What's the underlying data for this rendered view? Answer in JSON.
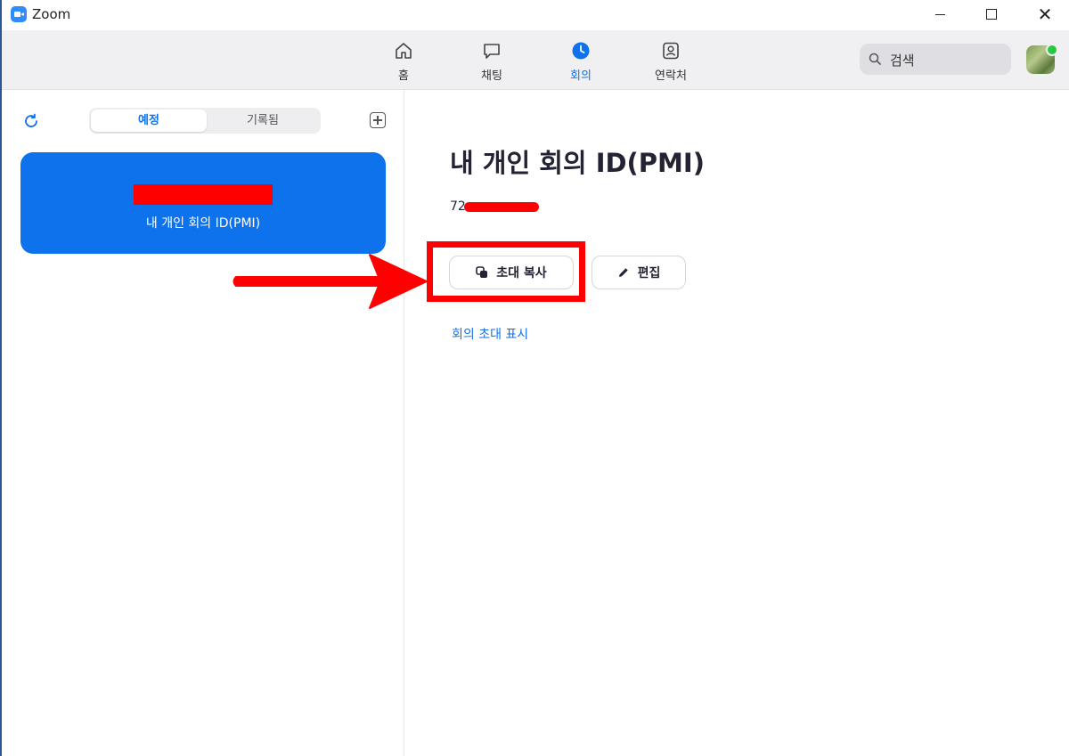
{
  "window": {
    "title": "Zoom"
  },
  "nav": {
    "items": [
      {
        "label": "홈",
        "icon": "home-icon",
        "active": false
      },
      {
        "label": "채팅",
        "icon": "chat-icon",
        "active": false
      },
      {
        "label": "회의",
        "icon": "clock-icon",
        "active": true
      },
      {
        "label": "연락처",
        "icon": "contacts-icon",
        "active": false
      }
    ],
    "search_placeholder": "검색"
  },
  "left": {
    "tabs": [
      {
        "label": "예정",
        "selected": true
      },
      {
        "label": "기록됨",
        "selected": false
      }
    ],
    "card": {
      "label": "내 개인 회의 ID(PMI)"
    }
  },
  "detail": {
    "title": "내 개인 회의 ID(PMI)",
    "meeting_id_prefix": "72",
    "copy_invite_label": "초대 복사",
    "edit_label": "편집",
    "show_invite_label": "회의 초대 표시"
  },
  "colors": {
    "accent": "#0e72ed",
    "annotation": "#ff0000"
  }
}
